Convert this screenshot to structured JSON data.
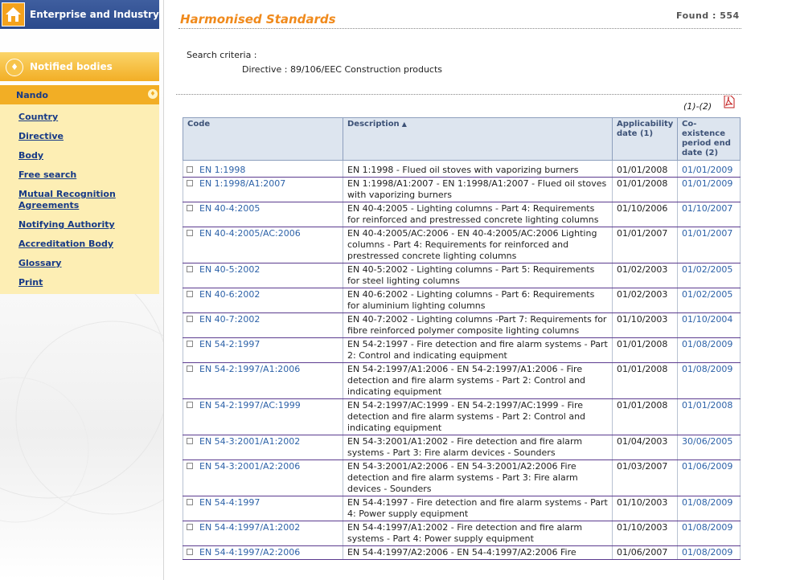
{
  "sidebar": {
    "enterprise_label": "Enterprise and Industry",
    "notified_label": "Notified bodies",
    "nando_label": "Nando",
    "menu": [
      {
        "label": "Country"
      },
      {
        "label": "Directive"
      },
      {
        "label": "Body"
      },
      {
        "label": "Free search"
      },
      {
        "label": "Mutual Recognition Agreements"
      },
      {
        "label": "Notifying Authority"
      },
      {
        "label": "Accreditation Body"
      },
      {
        "label": "Glossary"
      },
      {
        "label": "Print"
      }
    ]
  },
  "header": {
    "title": "Harmonised Standards",
    "found": "Found : 554"
  },
  "criteria": {
    "label": "Search criteria :",
    "value": "Directive : 89/106/EEC Construction products"
  },
  "pager": "(1)-(2)",
  "pdf_icon": "pdf-icon",
  "accent_colors": {
    "orange": "#f08a1c",
    "link": "#2d62a8",
    "navy": "#173a86"
  },
  "table": {
    "headers": {
      "code": "Code",
      "description": "Description",
      "applicability": "Applicability date (1)",
      "coexistence": "Co-existence period end date (2)"
    },
    "rows": [
      {
        "code": "EN 1:1998",
        "desc": "EN 1:1998 - Flued oil stoves with vaporizing burners",
        "app": "01/01/2008",
        "coex": "01/01/2009"
      },
      {
        "code": "EN 1:1998/A1:2007",
        "desc": "EN 1:1998/A1:2007 - EN 1:1998/A1:2007 - Flued oil stoves with vaporizing burners",
        "app": "01/01/2008",
        "coex": "01/01/2009"
      },
      {
        "code": "EN 40-4:2005",
        "desc": "EN 40-4:2005 - Lighting columns - Part 4: Requirements for reinforced and prestressed concrete lighting columns",
        "app": "01/10/2006",
        "coex": "01/10/2007"
      },
      {
        "code": "EN 40-4:2005/AC:2006",
        "desc": "EN 40-4:2005/AC:2006 - EN 40-4:2005/AC:2006 Lighting columns - Part 4: Requirements for reinforced and prestressed concrete lighting columns",
        "app": "01/01/2007",
        "coex": "01/01/2007"
      },
      {
        "code": "EN 40-5:2002",
        "desc": "EN 40-5:2002 - Lighting columns - Part 5: Requirements for steel lighting columns",
        "app": "01/02/2003",
        "coex": "01/02/2005"
      },
      {
        "code": "EN 40-6:2002",
        "desc": "EN 40-6:2002 - Lighting columns - Part 6: Requirements for aluminium lighting columns",
        "app": "01/02/2003",
        "coex": "01/02/2005"
      },
      {
        "code": "EN 40-7:2002",
        "desc": "EN 40-7:2002 - Lighting columns -Part 7: Requirements for fibre reinforced polymer composite lighting columns",
        "app": "01/10/2003",
        "coex": "01/10/2004"
      },
      {
        "code": "EN 54-2:1997",
        "desc": "EN 54-2:1997 - Fire detection and fire alarm systems - Part 2: Control and indicating equipment",
        "app": "01/01/2008",
        "coex": "01/08/2009"
      },
      {
        "code": "EN 54-2:1997/A1:2006",
        "desc": "EN 54-2:1997/A1:2006 - EN 54-2:1997/A1:2006 - Fire detection and fire alarm systems - Part 2: Control and indicating equipment",
        "app": "01/01/2008",
        "coex": "01/08/2009"
      },
      {
        "code": "EN 54-2:1997/AC:1999",
        "desc": "EN 54-2:1997/AC:1999 - EN 54-2:1997/AC:1999 - Fire detection and fire alarm systems - Part 2: Control and indicating equipment",
        "app": "01/01/2008",
        "coex": "01/01/2008"
      },
      {
        "code": "EN 54-3:2001/A1:2002",
        "desc": "EN 54-3:2001/A1:2002 - Fire detection and fire alarm systems - Part 3: Fire alarm devices - Sounders",
        "app": "01/04/2003",
        "coex": "30/06/2005"
      },
      {
        "code": "EN 54-3:2001/A2:2006",
        "desc": "EN 54-3:2001/A2:2006 - EN 54-3:2001/A2:2006 Fire detection and fire alarm systems - Part 3: Fire alarm devices - Sounders",
        "app": "01/03/2007",
        "coex": "01/06/2009"
      },
      {
        "code": "EN 54-4:1997",
        "desc": "EN 54-4:1997 - Fire detection and fire alarm systems - Part 4: Power supply equipment",
        "app": "01/10/2003",
        "coex": "01/08/2009"
      },
      {
        "code": "EN 54-4:1997/A1:2002",
        "desc": "EN 54-4:1997/A1:2002 - Fire detection and fire alarm systems - Part 4: Power supply equipment",
        "app": "01/10/2003",
        "coex": "01/08/2009"
      },
      {
        "code": "EN 54-4:1997/A2:2006",
        "desc": "EN 54-4:1997/A2:2006 - EN 54-4:1997/A2:2006 Fire",
        "app": "01/06/2007",
        "coex": "01/08/2009"
      }
    ]
  }
}
